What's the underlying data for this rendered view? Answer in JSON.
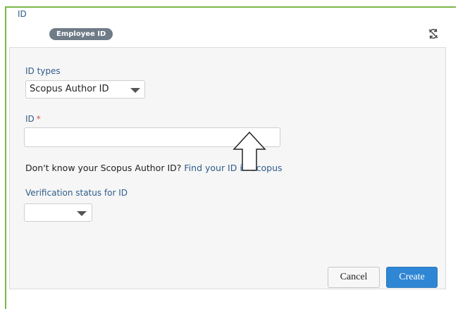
{
  "section": {
    "title": "ID",
    "badge": "Employee ID",
    "sync_icon": "sync-disabled-icon"
  },
  "form": {
    "id_types_label": "ID types",
    "id_types_value": "Scopus Author ID",
    "id_label": "ID",
    "id_required_marker": "*",
    "id_value": "",
    "help_text": "Don't know your Scopus Author ID?",
    "help_link": "Find your ID in Scopus",
    "verification_label": "Verification status for ID",
    "verification_value": ""
  },
  "annotation": {
    "arrow_icon": "up-arrow-icon"
  },
  "buttons": {
    "cancel": "Cancel",
    "create": "Create"
  },
  "colors": {
    "accent_green": "#7ab648",
    "label_blue": "#2f5c8a",
    "primary_button": "#2f86d4",
    "required_red": "#d9534f"
  }
}
